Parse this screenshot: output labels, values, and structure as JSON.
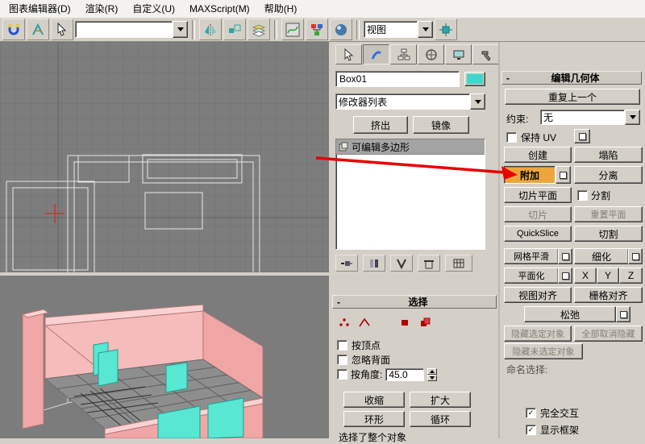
{
  "menu_bar": {
    "items": [
      "图表编辑器(D)",
      "渲染(R)",
      "自定义(U)",
      "MAXScript(M)",
      "帮助(H)"
    ]
  },
  "toolbar": {
    "coordsys_value": "视图"
  },
  "modify_panel": {
    "object_name": "Box01",
    "modifier_list_label": "修改器列表",
    "extrude_button": "挤出",
    "mirror_button": "镜像",
    "stack_item": "可编辑多边形",
    "selection_rollout": {
      "collapse_glyph": "-",
      "title": "选择",
      "by_vertex": "按顶点",
      "ignore_backfacing": "忽略背面",
      "by_angle": "按角度:",
      "angle_value": "45.0",
      "shrink": "收缩",
      "grow": "扩大",
      "ring": "环形",
      "loop": "循环",
      "status_text": "选择了整个对象"
    }
  },
  "edit_geometry": {
    "collapse_glyph": "-",
    "title": "编辑几何体",
    "repeat_last": "重复上一个",
    "constraints_label": "约束:",
    "constraints_value": "无",
    "preserve_uv": "保持 UV",
    "create": "创建",
    "collapse": "塌陷",
    "attach": "附加",
    "detach": "分离",
    "slice_plane": "切片平面",
    "split": "分割",
    "slice": "切片",
    "reset_plane": "重置平面",
    "quickslice": "QuickSlice",
    "cut": "切割",
    "msmooth": "网格平滑",
    "tessellate": "细化",
    "make_planar": "平面化",
    "axis_x": "X",
    "axis_y": "Y",
    "axis_z": "Z",
    "view_align": "视图对齐",
    "grid_align": "栅格对齐",
    "relax": "松弛",
    "hide_selected": "隐藏选定对象",
    "unhide_all": "全部取消隐藏",
    "hide_unselected": "隐藏未选定对象",
    "named_selections_label": "命名选择:",
    "full_interactivity": "完全交互",
    "show_cage": "显示框架"
  },
  "colors": {
    "attach_bg": "#eda63c",
    "object_swatch": "#3fd6ce",
    "arrow": "#e80000",
    "wall": "#f1a6a6",
    "wall_light": "#f6bcbc",
    "wall_top": "#fbd2d2",
    "glass": "#58e7d2"
  },
  "icons": {
    "checkmark": "✓"
  }
}
